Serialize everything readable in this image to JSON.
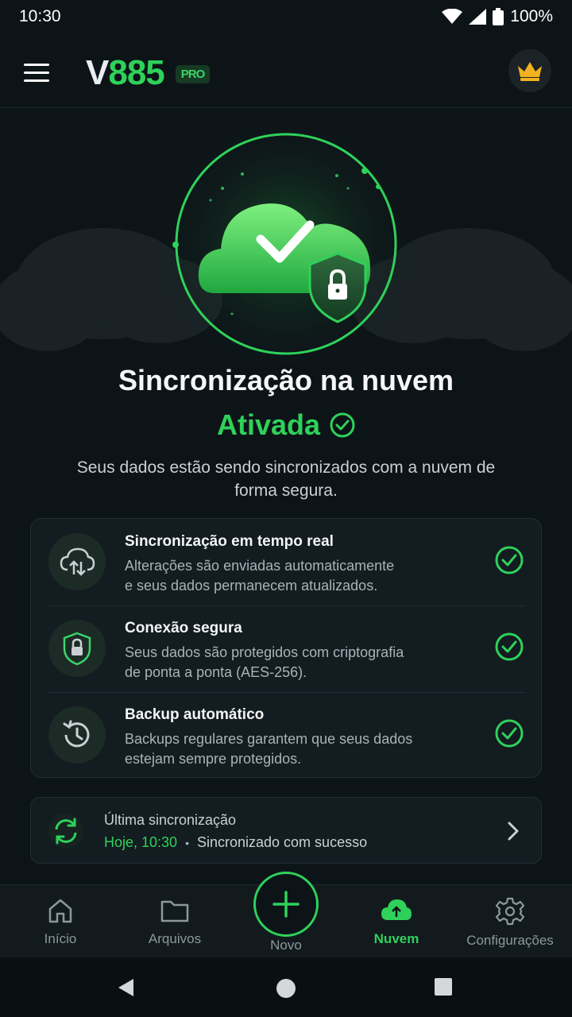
{
  "status_bar": {
    "time": "10:30",
    "battery": "100%"
  },
  "app_bar": {
    "logo_v": "V",
    "logo_num": "885",
    "badge": "PRO"
  },
  "hero": {
    "title": "Sincronização na nuvem",
    "status": "Ativada",
    "subtitle": "Seus dados estão sendo sincronizados com a nuvem de forma segura."
  },
  "features": [
    {
      "icon": "cloud-sync-icon",
      "title": "Sincronização em tempo real",
      "desc_1": "Alterações são enviadas automaticamente",
      "desc_2": "e seus dados permanecem atualizados."
    },
    {
      "icon": "shield-lock-icon",
      "title": "Conexão segura",
      "desc_1": "Seus dados são protegidos com criptografia",
      "desc_2": "de ponta a ponta (AES-256)."
    },
    {
      "icon": "history-icon",
      "title": "Backup automático",
      "desc_1": "Backups regulares garantem que seus dados",
      "desc_2": "estejam sempre protegidos."
    }
  ],
  "last_sync": {
    "label": "Última sincronização",
    "time": "Hoje, 10:30",
    "separator": "•",
    "status": "Sincronizado com sucesso"
  },
  "bottom_nav": {
    "items": [
      {
        "label": "Início",
        "icon": "home-icon"
      },
      {
        "label": "Arquivos",
        "icon": "folder-icon"
      },
      {
        "label": "Novo",
        "icon": "plus-icon"
      },
      {
        "label": "Nuvem",
        "icon": "cloud-icon",
        "active": true
      },
      {
        "label": "Configurações",
        "icon": "gear-icon"
      }
    ]
  },
  "colors": {
    "accent": "#2fd15a",
    "background": "#0d1418",
    "card": "#131c20"
  }
}
